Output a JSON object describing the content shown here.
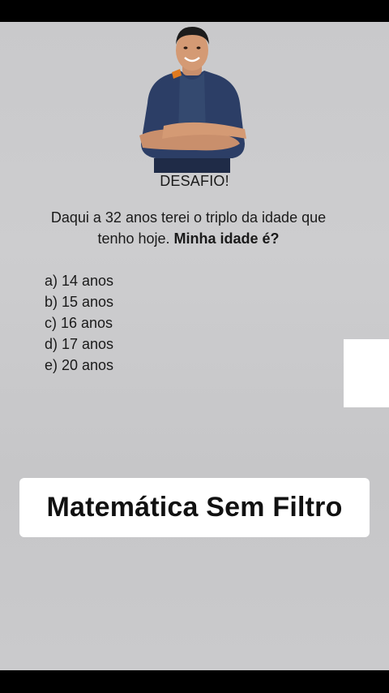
{
  "frame": {
    "title": "DESAFIO!",
    "question_normal": "Daqui a 32 anos terei o triplo da idade que tenho hoje.",
    "question_bold": "Minha idade é?",
    "options": [
      "a) 14 anos",
      "b) 15 anos",
      "c) 16 anos",
      "d) 17 anos",
      "e) 20 anos"
    ]
  },
  "caption": {
    "text": "Matemática Sem Filtro"
  },
  "colors": {
    "background": "#cacacc",
    "shirt": "#2c3e66",
    "text": "#1a1a1a"
  },
  "icons": {
    "presenter": "man-with-crossed-arms-photo"
  }
}
